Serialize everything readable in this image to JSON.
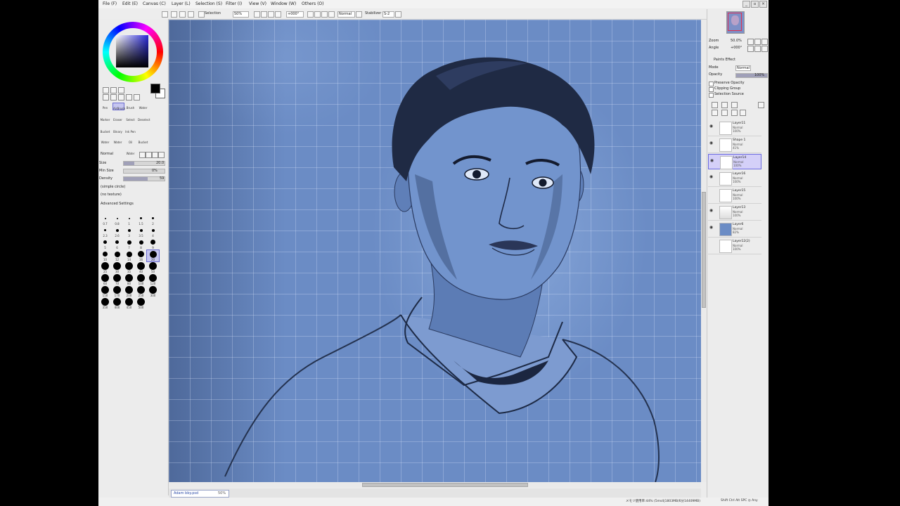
{
  "menu": [
    "File (F)",
    "Edit (E)",
    "Canvas (C)",
    "Layer (L)",
    "Selection (S)",
    "Filter (I)",
    "View (V)",
    "Window (W)",
    "Others (O)"
  ],
  "toolbar": {
    "selection_label": "Selection",
    "zoom_value": "50%",
    "angle_value": "+000°",
    "blend_mode": "Normal",
    "stabilizer_label": "Stabilizer",
    "stabilizer_value": "S-2"
  },
  "tools": {
    "brush_tabs": [
      "Pen",
      "AirBrush",
      "Brush",
      "Water",
      "Marker",
      "Eraser",
      "Select",
      "Deselect",
      "Bucket",
      "Binary",
      "Ink Pen",
      "",
      "Water",
      "Water",
      "Oil Water",
      "Bucket"
    ],
    "blend_label": "Normal",
    "size_label": "Size",
    "size_value": "20.0",
    "min_size_label": "Min Size",
    "min_size_value": "0%",
    "density_label": "Density",
    "density_value": "59",
    "shape_label": "(simple circle)",
    "texture_label": "(no texture)",
    "advanced_label": "Advanced Settings",
    "size_presets": [
      "0.7",
      "0.8",
      "1",
      "1.5",
      "2",
      "2.3",
      "2.6",
      "3",
      "3.5",
      "4",
      "5",
      "6",
      "7",
      "8",
      "9",
      "10",
      "12",
      "14",
      "16",
      "20",
      "25",
      "30",
      "35",
      "40",
      "50",
      "60",
      "70",
      "80",
      "100",
      "120",
      "150",
      "170",
      "200",
      "250",
      "300",
      "350",
      "400",
      "450",
      "500"
    ],
    "selected_preset": "20"
  },
  "navigator": {
    "zoom_label": "Zoom",
    "zoom_value": "50.0%",
    "angle_label": "Angle",
    "angle_value": "+000°"
  },
  "layer_panel": {
    "paints_effect": "Paints Effect",
    "mode_label": "Mode",
    "mode_value": "Normal",
    "opacity_label": "Opacity",
    "opacity_value": "100%",
    "opt_preserve": "Preserve Opacity",
    "opt_clipping": "Clipping Group",
    "opt_selection": "Selection Source",
    "layers": [
      {
        "name": "Layer11",
        "mode": "Normal",
        "opacity": "100%",
        "visible": true,
        "selected": false
      },
      {
        "name": "Shape 1",
        "mode": "Normal",
        "opacity": "41%",
        "visible": true,
        "selected": false
      },
      {
        "name": "Layer14",
        "mode": "Normal",
        "opacity": "100%",
        "visible": true,
        "selected": true
      },
      {
        "name": "Layer16",
        "mode": "Normal",
        "opacity": "100%",
        "visible": true,
        "selected": false
      },
      {
        "name": "Layer15",
        "mode": "Normal",
        "opacity": "100%",
        "visible": false,
        "selected": false
      },
      {
        "name": "Layer13",
        "mode": "Normal",
        "opacity": "100%",
        "visible": true,
        "selected": false
      },
      {
        "name": "Layer6",
        "mode": "Normal",
        "opacity": "82%",
        "visible": true,
        "selected": false
      },
      {
        "name": "Layer12(2)",
        "mode": "Normal",
        "opacity": "100%",
        "visible": false,
        "selected": false
      }
    ]
  },
  "document_tab": {
    "name": "Adam bby.psd",
    "zoom": "50%"
  },
  "status": {
    "memory": "メモリ使用率:44% (5ms4|1803MB/6分14409MB)",
    "keys": "Shift Ctrl Alt SPC ◎ Any"
  },
  "colors": {
    "canvas_blue": "#6b8cc5",
    "selection_highlight": "#d4d0f8",
    "accent": "#6a6ae0"
  }
}
